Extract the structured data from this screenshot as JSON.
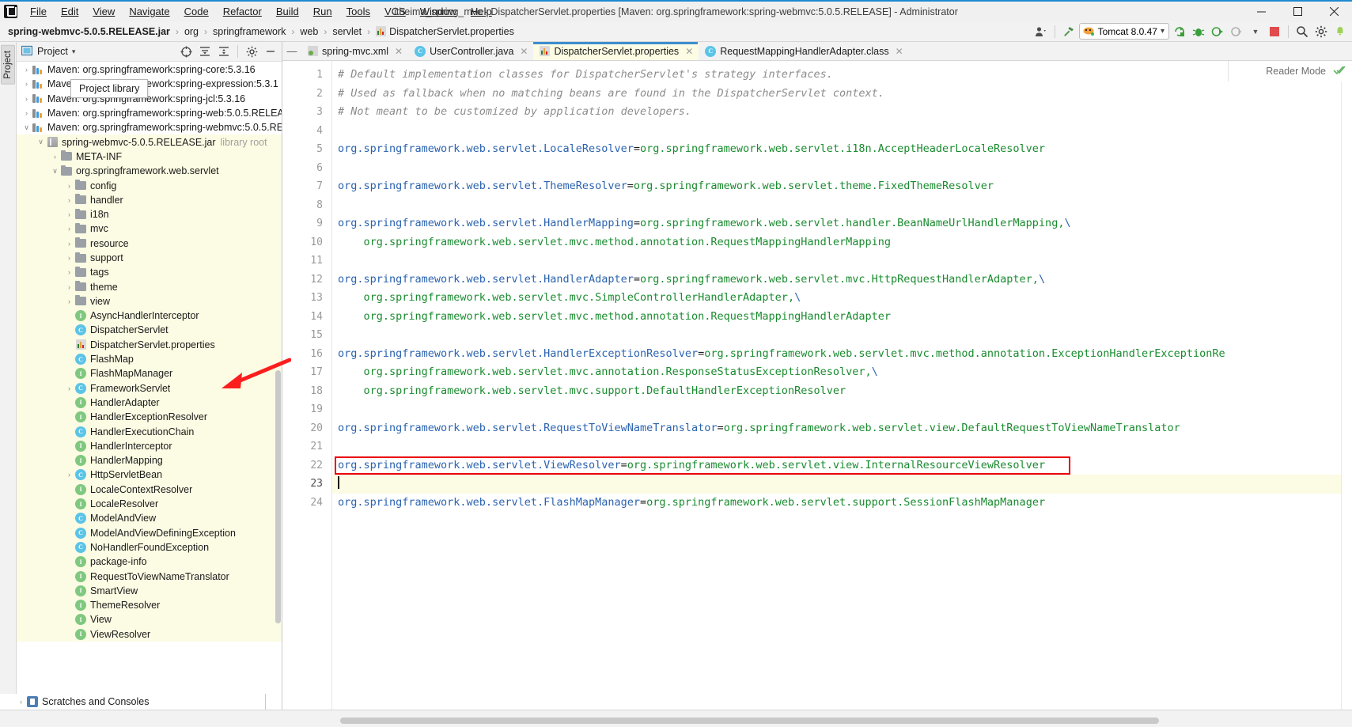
{
  "window": {
    "title": "itheima_spring_mvc - DispatcherServlet.properties [Maven: org.springframework:spring-webmvc:5.0.5.RELEASE] - Administrator",
    "minimize": "─",
    "maximize": "☐",
    "close": "✕"
  },
  "menubar": {
    "items": [
      {
        "label": "File"
      },
      {
        "label": "Edit"
      },
      {
        "label": "View"
      },
      {
        "label": "Navigate"
      },
      {
        "label": "Code"
      },
      {
        "label": "Refactor"
      },
      {
        "label": "Build"
      },
      {
        "label": "Run"
      },
      {
        "label": "Tools"
      },
      {
        "label": "VCS"
      },
      {
        "label": "Window"
      },
      {
        "label": "Help"
      }
    ]
  },
  "breadcrumb": {
    "items": [
      {
        "label": "spring-webmvc-5.0.5.RELEASE.jar",
        "bold": true,
        "icon": "none"
      },
      {
        "label": "org",
        "bold": false,
        "icon": "none"
      },
      {
        "label": "springframework",
        "bold": false,
        "icon": "none"
      },
      {
        "label": "web",
        "bold": false,
        "icon": "none"
      },
      {
        "label": "servlet",
        "bold": false,
        "icon": "none"
      },
      {
        "label": "DispatcherServlet.properties",
        "bold": false,
        "icon": "properties"
      }
    ],
    "separator": "›"
  },
  "toolbar": {
    "run_configuration": "Tomcat 8.0.47",
    "dropdown_caret": "▾"
  },
  "project_panel": {
    "title": "Project",
    "dropdown": "▾",
    "tooltip": "Project library",
    "tree": [
      {
        "indent": 1,
        "arrow": "›",
        "icon": "lib",
        "label": "Maven: org.springframework:spring-core:5.3.16",
        "meta": "",
        "hl": false
      },
      {
        "indent": 1,
        "arrow": "›",
        "icon": "lib",
        "label": "Maven: org.springframework:spring-expression:5.3.1",
        "meta": "",
        "hl": false
      },
      {
        "indent": 1,
        "arrow": "›",
        "icon": "lib",
        "label": "Maven: org.springframework:spring-jcl:5.3.16",
        "meta": "",
        "hl": false
      },
      {
        "indent": 1,
        "arrow": "›",
        "icon": "lib",
        "label": "Maven: org.springframework:spring-web:5.0.5.RELEA",
        "meta": "",
        "hl": false
      },
      {
        "indent": 1,
        "arrow": "∨",
        "icon": "lib",
        "label": "Maven: org.springframework:spring-webmvc:5.0.5.RE",
        "meta": "",
        "hl": false
      },
      {
        "indent": 2,
        "arrow": "∨",
        "icon": "jar",
        "label": "spring-webmvc-5.0.5.RELEASE.jar",
        "meta": "library root",
        "hl": true
      },
      {
        "indent": 3,
        "arrow": "›",
        "icon": "folder",
        "label": "META-INF",
        "meta": "",
        "hl": true
      },
      {
        "indent": 3,
        "arrow": "∨",
        "icon": "folder",
        "label": "org.springframework.web.servlet",
        "meta": "",
        "hl": true
      },
      {
        "indent": 4,
        "arrow": "›",
        "icon": "folder",
        "label": "config",
        "meta": "",
        "hl": true
      },
      {
        "indent": 4,
        "arrow": "›",
        "icon": "folder",
        "label": "handler",
        "meta": "",
        "hl": true
      },
      {
        "indent": 4,
        "arrow": "›",
        "icon": "folder",
        "label": "i18n",
        "meta": "",
        "hl": true
      },
      {
        "indent": 4,
        "arrow": "›",
        "icon": "folder",
        "label": "mvc",
        "meta": "",
        "hl": true
      },
      {
        "indent": 4,
        "arrow": "›",
        "icon": "folder",
        "label": "resource",
        "meta": "",
        "hl": true
      },
      {
        "indent": 4,
        "arrow": "›",
        "icon": "folder",
        "label": "support",
        "meta": "",
        "hl": true
      },
      {
        "indent": 4,
        "arrow": "›",
        "icon": "folder",
        "label": "tags",
        "meta": "",
        "hl": true
      },
      {
        "indent": 4,
        "arrow": "›",
        "icon": "folder",
        "label": "theme",
        "meta": "",
        "hl": true
      },
      {
        "indent": 4,
        "arrow": "›",
        "icon": "folder",
        "label": "view",
        "meta": "",
        "hl": true
      },
      {
        "indent": 4,
        "arrow": "",
        "icon": "iface",
        "label": "AsyncHandlerInterceptor",
        "meta": "",
        "hl": true
      },
      {
        "indent": 4,
        "arrow": "",
        "icon": "class",
        "label": "DispatcherServlet",
        "meta": "",
        "hl": true
      },
      {
        "indent": 4,
        "arrow": "",
        "icon": "props",
        "label": "DispatcherServlet.properties",
        "meta": "",
        "hl": true
      },
      {
        "indent": 4,
        "arrow": "",
        "icon": "class",
        "label": "FlashMap",
        "meta": "",
        "hl": true
      },
      {
        "indent": 4,
        "arrow": "",
        "icon": "iface",
        "label": "FlashMapManager",
        "meta": "",
        "hl": true
      },
      {
        "indent": 4,
        "arrow": "›",
        "icon": "class",
        "label": "FrameworkServlet",
        "meta": "",
        "hl": true
      },
      {
        "indent": 4,
        "arrow": "",
        "icon": "iface",
        "label": "HandlerAdapter",
        "meta": "",
        "hl": true
      },
      {
        "indent": 4,
        "arrow": "",
        "icon": "iface",
        "label": "HandlerExceptionResolver",
        "meta": "",
        "hl": true
      },
      {
        "indent": 4,
        "arrow": "",
        "icon": "class",
        "label": "HandlerExecutionChain",
        "meta": "",
        "hl": true
      },
      {
        "indent": 4,
        "arrow": "",
        "icon": "iface",
        "label": "HandlerInterceptor",
        "meta": "",
        "hl": true
      },
      {
        "indent": 4,
        "arrow": "",
        "icon": "iface",
        "label": "HandlerMapping",
        "meta": "",
        "hl": true
      },
      {
        "indent": 4,
        "arrow": "›",
        "icon": "class",
        "label": "HttpServletBean",
        "meta": "",
        "hl": true
      },
      {
        "indent": 4,
        "arrow": "",
        "icon": "iface",
        "label": "LocaleContextResolver",
        "meta": "",
        "hl": true
      },
      {
        "indent": 4,
        "arrow": "",
        "icon": "iface",
        "label": "LocaleResolver",
        "meta": "",
        "hl": true
      },
      {
        "indent": 4,
        "arrow": "",
        "icon": "class",
        "label": "ModelAndView",
        "meta": "",
        "hl": true
      },
      {
        "indent": 4,
        "arrow": "",
        "icon": "class",
        "label": "ModelAndViewDefiningException",
        "meta": "",
        "hl": true
      },
      {
        "indent": 4,
        "arrow": "",
        "icon": "class",
        "label": "NoHandlerFoundException",
        "meta": "",
        "hl": true
      },
      {
        "indent": 4,
        "arrow": "",
        "icon": "iface",
        "label": "package-info",
        "meta": "",
        "hl": true
      },
      {
        "indent": 4,
        "arrow": "",
        "icon": "iface",
        "label": "RequestToViewNameTranslator",
        "meta": "",
        "hl": true
      },
      {
        "indent": 4,
        "arrow": "",
        "icon": "iface",
        "label": "SmartView",
        "meta": "",
        "hl": true
      },
      {
        "indent": 4,
        "arrow": "",
        "icon": "iface",
        "label": "ThemeResolver",
        "meta": "",
        "hl": true
      },
      {
        "indent": 4,
        "arrow": "",
        "icon": "iface",
        "label": "View",
        "meta": "",
        "hl": true
      },
      {
        "indent": 4,
        "arrow": "",
        "icon": "iface",
        "label": "ViewResolver",
        "meta": "",
        "hl": true
      }
    ],
    "scratches_label": "Scratches and Consoles"
  },
  "editor_tabs": [
    {
      "label": "spring-mvc.xml",
      "icon": "xml",
      "active": false,
      "closable": true
    },
    {
      "label": "UserController.java",
      "icon": "class",
      "active": false,
      "closable": true
    },
    {
      "label": "DispatcherServlet.properties",
      "icon": "props",
      "active": true,
      "closable": true
    },
    {
      "label": "RequestMappingHandlerAdapter.class",
      "icon": "class",
      "active": false,
      "closable": true
    }
  ],
  "editor": {
    "reader_mode_label": "Reader Mode",
    "line_numbers": [
      "1",
      "2",
      "3",
      "4",
      "5",
      "6",
      "7",
      "8",
      "9",
      "10",
      "11",
      "12",
      "13",
      "14",
      "15",
      "16",
      "17",
      "18",
      "19",
      "20",
      "21",
      "22",
      "23",
      "24"
    ],
    "caret_line": 23,
    "highlighted_line": 22,
    "lines": [
      {
        "n": 1,
        "type": "comment",
        "text": "# Default implementation classes for DispatcherServlet's strategy interfaces."
      },
      {
        "n": 2,
        "type": "comment",
        "text": "# Used as fallback when no matching beans are found in the DispatcherServlet context."
      },
      {
        "n": 3,
        "type": "comment",
        "text": "# Not meant to be customized by application developers."
      },
      {
        "n": 4,
        "type": "blank",
        "text": ""
      },
      {
        "n": 5,
        "type": "prop",
        "key": "org.springframework.web.servlet.LocaleResolver",
        "value": "org.springframework.web.servlet.i18n.AcceptHeaderLocaleResolver",
        "cont": ""
      },
      {
        "n": 6,
        "type": "blank",
        "text": ""
      },
      {
        "n": 7,
        "type": "prop",
        "key": "org.springframework.web.servlet.ThemeResolver",
        "value": "org.springframework.web.servlet.theme.FixedThemeResolver",
        "cont": ""
      },
      {
        "n": 8,
        "type": "blank",
        "text": ""
      },
      {
        "n": 9,
        "type": "prop",
        "key": "org.springframework.web.servlet.HandlerMapping",
        "value": "org.springframework.web.servlet.handler.BeanNameUrlHandlerMapping,",
        "cont": "\\"
      },
      {
        "n": 10,
        "type": "cont",
        "text": "org.springframework.web.servlet.mvc.method.annotation.RequestMappingHandlerMapping",
        "cont": ""
      },
      {
        "n": 11,
        "type": "blank",
        "text": ""
      },
      {
        "n": 12,
        "type": "prop",
        "key": "org.springframework.web.servlet.HandlerAdapter",
        "value": "org.springframework.web.servlet.mvc.HttpRequestHandlerAdapter,",
        "cont": "\\"
      },
      {
        "n": 13,
        "type": "cont",
        "text": "org.springframework.web.servlet.mvc.SimpleControllerHandlerAdapter,",
        "cont": "\\"
      },
      {
        "n": 14,
        "type": "cont",
        "text": "org.springframework.web.servlet.mvc.method.annotation.RequestMappingHandlerAdapter",
        "cont": ""
      },
      {
        "n": 15,
        "type": "blank",
        "text": ""
      },
      {
        "n": 16,
        "type": "prop",
        "key": "org.springframework.web.servlet.HandlerExceptionResolver",
        "value": "org.springframework.web.servlet.mvc.method.annotation.ExceptionHandlerExceptionRe",
        "cont": ""
      },
      {
        "n": 17,
        "type": "cont",
        "text": "org.springframework.web.servlet.mvc.annotation.ResponseStatusExceptionResolver,",
        "cont": "\\"
      },
      {
        "n": 18,
        "type": "cont",
        "text": "org.springframework.web.servlet.mvc.support.DefaultHandlerExceptionResolver",
        "cont": ""
      },
      {
        "n": 19,
        "type": "blank",
        "text": ""
      },
      {
        "n": 20,
        "type": "prop",
        "key": "org.springframework.web.servlet.RequestToViewNameTranslator",
        "value": "org.springframework.web.servlet.view.DefaultRequestToViewNameTranslator",
        "cont": ""
      },
      {
        "n": 21,
        "type": "blank",
        "text": ""
      },
      {
        "n": 22,
        "type": "prop",
        "key": "org.springframework.web.servlet.ViewResolver",
        "value": "org.springframework.web.servlet.view.InternalResourceViewResolver",
        "cont": ""
      },
      {
        "n": 23,
        "type": "caret",
        "text": ""
      },
      {
        "n": 24,
        "type": "prop",
        "key": "org.springframework.web.servlet.FlashMapManager",
        "value": "org.springframework.web.servlet.support.SessionFlashMapManager",
        "cont": ""
      }
    ]
  },
  "colors": {
    "accent": "#3b8ed0",
    "key": "#2b63b0",
    "value": "#1a8b2f",
    "comment": "#8c8c8c",
    "highlight_box": "#e8000b",
    "selection_bg": "#fcfbe3",
    "annotation_arrow": "#fb1e1e"
  },
  "annotation": {
    "arrow_color": "#fb1e1e",
    "points_to": "DispatcherServlet.properties"
  }
}
